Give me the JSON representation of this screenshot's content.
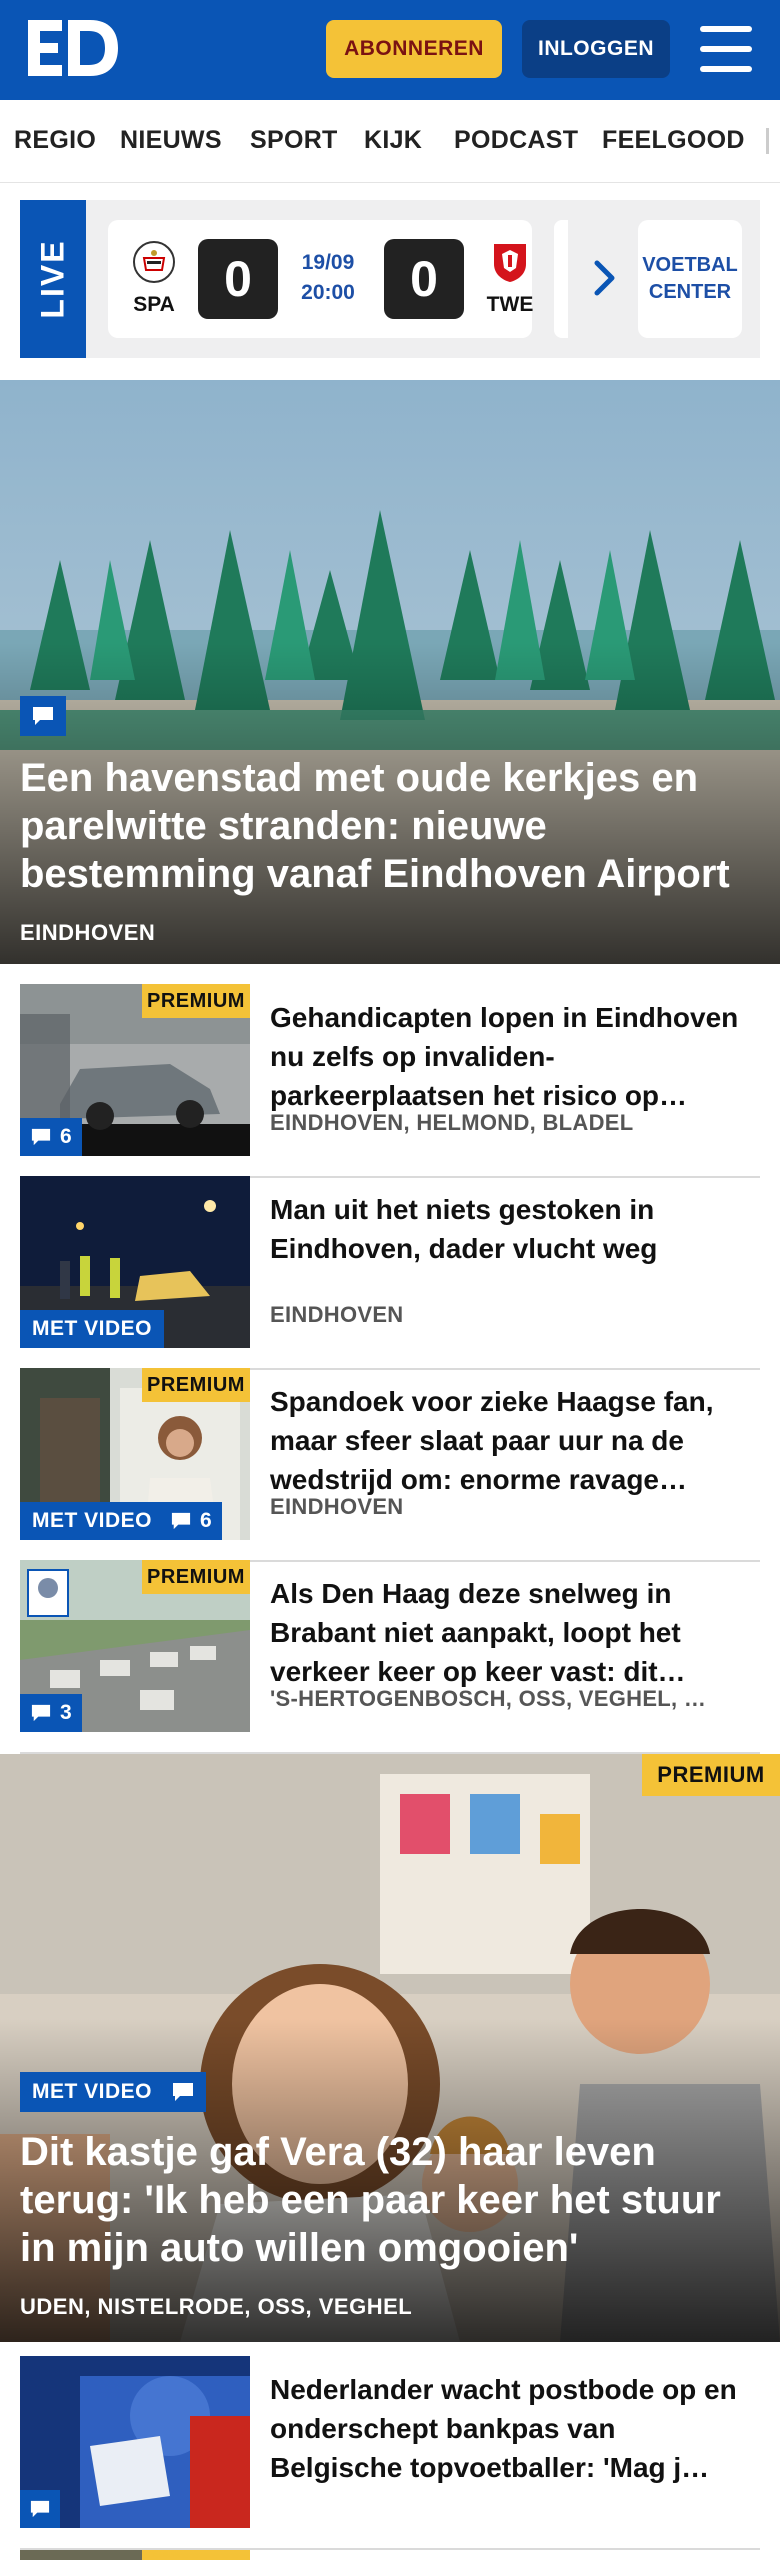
{
  "header": {
    "logo_text": "ED",
    "subscribe_label": "ABONNEREN",
    "login_label": "INLOGGEN",
    "menu_icon": "hamburger-menu-icon"
  },
  "nav": {
    "items": [
      "REGIO",
      "NIEUWS",
      "SPORT",
      "KIJK",
      "PODCAST",
      "FEELGOOD"
    ]
  },
  "live": {
    "label": "LIVE",
    "match": {
      "home": "SPA",
      "away": "TWE",
      "home_score": "0",
      "away_score": "0",
      "date": "19/09",
      "time": "20:00"
    },
    "voetbal_center_line1": "VOETBAL",
    "voetbal_center_line2": "CENTER"
  },
  "hero_article": {
    "title": "Een havenstad met oude kerkjes en parelwitte stranden: nieuwe bestemming vanaf Eindhoven Airport",
    "location": "EINDHOVEN"
  },
  "articles": [
    {
      "title": "Gehandicapten lopen in Eindhoven nu zelfs op invaliden-parkeerplaatsen het risico op…",
      "location": "EINDHOVEN, HELMOND, BLADEL",
      "premium": "PREMIUM",
      "comments": "6"
    },
    {
      "title": "Man uit het niets gestoken in Eindhoven, dader vlucht weg",
      "location": "EINDHOVEN",
      "video": "MET VIDEO"
    },
    {
      "title": "Spandoek voor zieke Haagse fan, maar sfeer slaat paar uur na de wedstrijd om: enorme ravage…",
      "location": "EINDHOVEN",
      "premium": "PREMIUM",
      "video": "MET VIDEO",
      "comments": "6"
    },
    {
      "title": "Als Den Haag deze snelweg in Brabant niet aanpakt, loopt het verkeer keer op keer vast: dit…",
      "location": "'S-HERTOGENBOSCH, OSS, VEGHEL, …",
      "premium": "PREMIUM",
      "comments": "3"
    }
  ],
  "hero_article_2": {
    "title": "Dit kastje gaf Vera (32) haar leven terug: 'Ik heb een paar keer het stuur in mijn auto willen omgooien'",
    "location": "UDEN, NISTELRODE, OSS, VEGHEL",
    "premium": "PREMIUM",
    "video": "MET VIDEO"
  },
  "article_last": {
    "title": "Nederlander wacht postbode op en onderschept bankpas van Belgische topvoetballer: 'Mag j…",
    "premium_partial": "PREMIUM"
  },
  "colors": {
    "brand_blue": "#0a55b5",
    "premium_yellow": "#f4c237",
    "subscribe_text": "#7a1212"
  }
}
